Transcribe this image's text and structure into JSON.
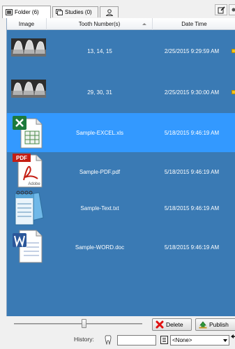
{
  "tabs": [
    {
      "label": "Folder (6)",
      "icon": "image-folder-icon",
      "active": true
    },
    {
      "label": "Studies (0)",
      "icon": "studies-icon",
      "active": false
    },
    {
      "label": "",
      "icon": "person-icon",
      "active": false
    }
  ],
  "columns": {
    "image": "Image",
    "tooth": "Tooth Number(s)",
    "date": "Date Time"
  },
  "rows": [
    {
      "tooth": "13, 14, 15",
      "date": "2/25/2015 9:29:59 AM",
      "thumb": "xray-thumbnail",
      "selected": false,
      "note": true
    },
    {
      "tooth": "29, 30, 31",
      "date": "2/25/2015 9:30:00 AM",
      "thumb": "xray-thumbnail",
      "selected": false,
      "note": true
    },
    {
      "tooth": "Sample-EXCEL.xls",
      "date": "5/18/2015 9:46:19 AM",
      "thumb": "excel-file-icon",
      "selected": true,
      "note": false
    },
    {
      "tooth": "Sample-PDF.pdf",
      "date": "5/18/2015 9:46:19 AM",
      "thumb": "pdf-file-icon",
      "selected": false,
      "note": false
    },
    {
      "tooth": "Sample-Text.txt",
      "date": "5/18/2015 9:46:19 AM",
      "thumb": "text-file-icon",
      "selected": false,
      "note": false
    },
    {
      "tooth": "Sample-WORD.doc",
      "date": "5/18/2015 9:46:19 AM",
      "thumb": "word-file-icon",
      "selected": false,
      "note": false
    }
  ],
  "thumb_labels": {
    "pdf": "PDF",
    "adobe": "Adobe"
  },
  "bottom": {
    "zoom_level": 0.53,
    "delete_label": "Delete",
    "publish_label": "Publish",
    "history_label": "History:",
    "history_value": "",
    "select_value": "<None>"
  },
  "colors": {
    "panel_bg": "#3a7ab4",
    "selected_row": "#3399ff"
  }
}
